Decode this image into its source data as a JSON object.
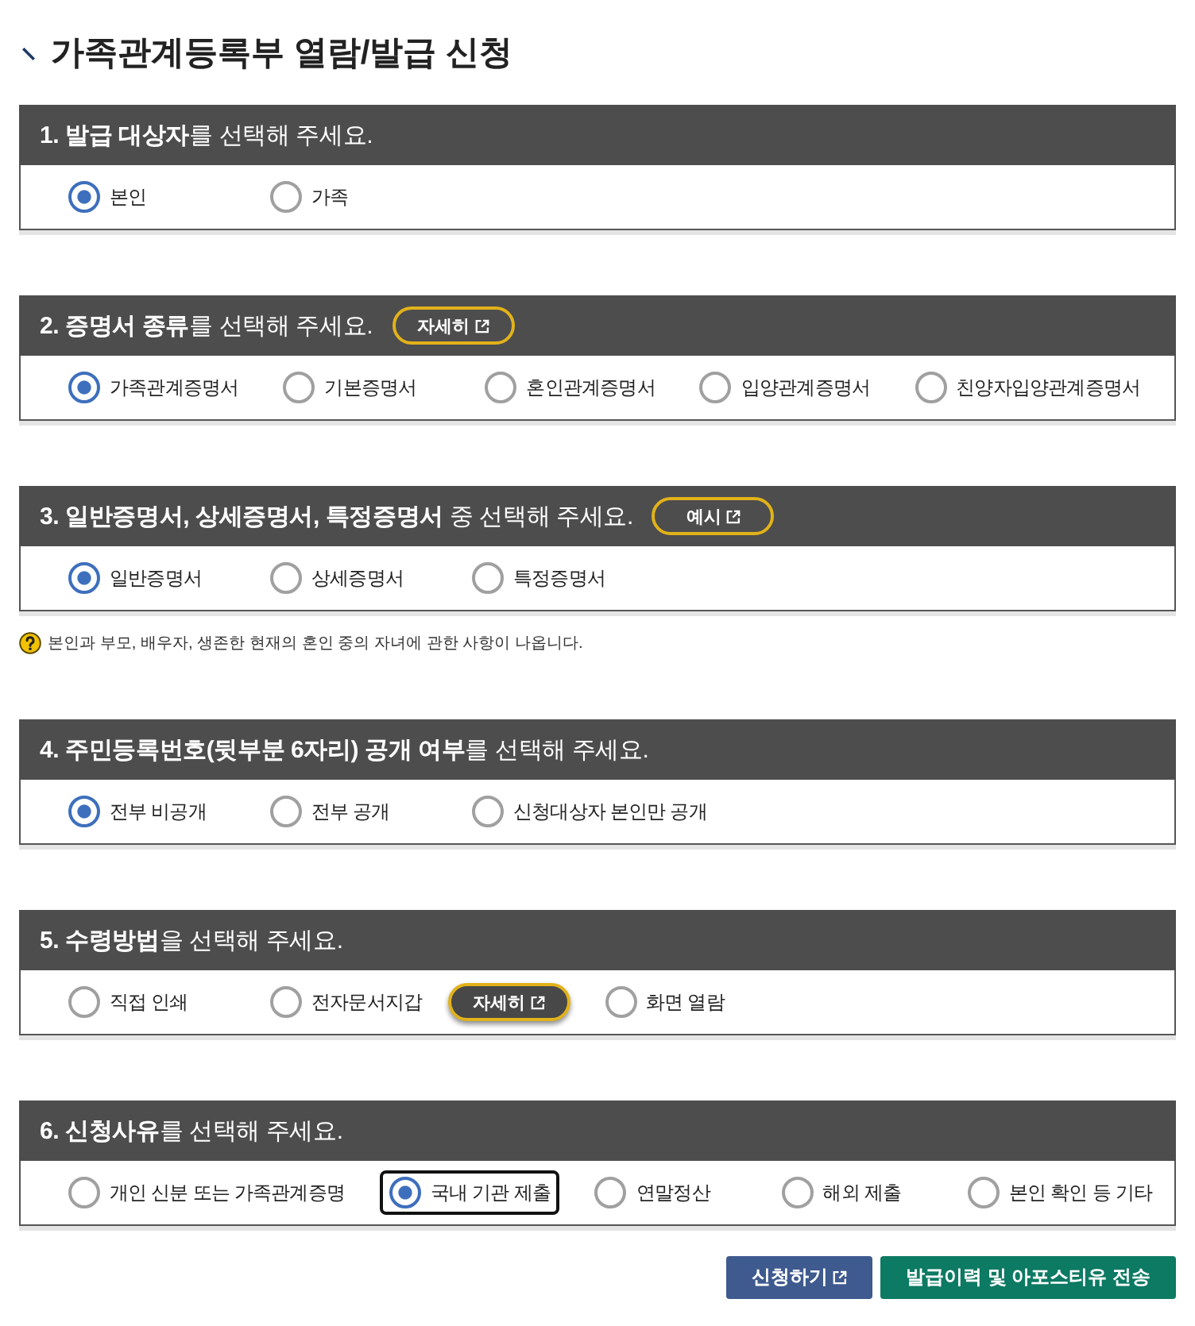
{
  "page": {
    "title": "가족관계등록부 열람/발급 신청"
  },
  "sections": [
    {
      "heading": "**1. 발급 대상자**를 선택해 주세요.",
      "options": [
        {
          "label": "본인",
          "selected": true
        },
        {
          "label": "가족",
          "selected": false
        }
      ]
    },
    {
      "heading": "**2. 증명서 종류**를 선택해 주세요.",
      "header_button": {
        "label": "자세히"
      },
      "options": [
        {
          "label": "가족관계증명서",
          "selected": true
        },
        {
          "label": "기본증명서",
          "selected": false
        },
        {
          "label": "혼인관계증명서",
          "selected": false
        },
        {
          "label": "입양관계증명서",
          "selected": false
        },
        {
          "label": "친양자입양관계증명서",
          "selected": false
        }
      ]
    },
    {
      "heading": "**3. 일반증명서, 상세증명서, 특정증명서** 중 선택해 주세요.",
      "header_button": {
        "label": "예시"
      },
      "options": [
        {
          "label": "일반증명서",
          "selected": true
        },
        {
          "label": "상세증명서",
          "selected": false
        },
        {
          "label": "특정증명서",
          "selected": false
        }
      ],
      "note": "본인과 부모, 배우자, 생존한 현재의 혼인 중의 자녀에 관한 사항이 나옵니다."
    },
    {
      "heading": "**4. 주민등록번호(뒷부분 6자리) 공개 여부**를 선택해 주세요.",
      "options": [
        {
          "label": "전부 비공개",
          "selected": true
        },
        {
          "label": "전부 공개",
          "selected": false
        },
        {
          "label": "신청대상자 본인만 공개",
          "selected": false
        }
      ]
    },
    {
      "heading": "**5. 수령방법**을 선택해 주세요.",
      "options": [
        {
          "label": "직접 인쇄",
          "selected": false
        },
        {
          "label": "전자문서지갑",
          "selected": false,
          "button": {
            "label": "자세히"
          }
        },
        {
          "label": "화면 열람",
          "selected": false
        }
      ]
    },
    {
      "heading": "**6. 신청사유**를 선택해 주세요.",
      "options": [
        {
          "label": "개인 신분 또는 가족관계증명",
          "selected": false,
          "focused": false
        },
        {
          "label": "국내 기관 제출",
          "selected": true,
          "focused": true
        },
        {
          "label": "연말정산",
          "selected": false,
          "focused": false
        },
        {
          "label": "해외 제출",
          "selected": false,
          "focused": false
        },
        {
          "label": "본인 확인 등 기타",
          "selected": false,
          "focused": false
        }
      ]
    }
  ],
  "actions": [
    {
      "label": "신청하기",
      "kind": "primary",
      "external": true
    },
    {
      "label": "발급이력 및 아포스티유 전송",
      "kind": "secondary",
      "external": false
    }
  ]
}
